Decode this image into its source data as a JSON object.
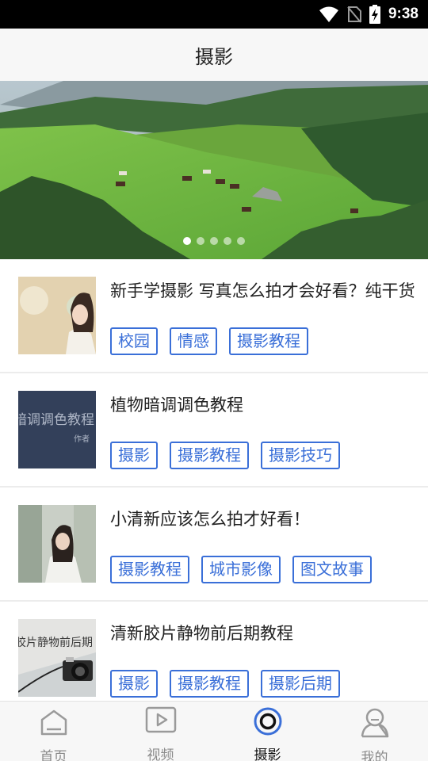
{
  "status_bar": {
    "time": "9:38"
  },
  "header": {
    "title": "摄影"
  },
  "banner": {
    "page_count": 5,
    "active_page": 1
  },
  "articles": [
    {
      "title": "新手学摄影 写真怎么拍才会好看？纯干货",
      "tags": [
        "校园",
        "情感",
        "摄影教程"
      ]
    },
    {
      "title": "植物暗调调色教程",
      "thumb_text": "暗调调色教程",
      "thumb_subtext": "作者",
      "tags": [
        "摄影",
        "摄影教程",
        "摄影技巧"
      ]
    },
    {
      "title": "小清新应该怎么拍才好看！",
      "tags": [
        "摄影教程",
        "城市影像",
        "图文故事"
      ]
    },
    {
      "title": "清新胶片静物前后期教程",
      "thumb_text": "胶片静物前后期",
      "tags": [
        "摄影",
        "摄影教程",
        "摄影后期"
      ]
    }
  ],
  "tabbar": {
    "tabs": [
      {
        "label": "首页",
        "icon": "home-icon"
      },
      {
        "label": "视频",
        "icon": "video-icon"
      },
      {
        "label": "摄影",
        "icon": "camera-lens-icon",
        "active": true
      },
      {
        "label": "我的",
        "icon": "profile-icon"
      }
    ]
  },
  "colors": {
    "accent": "#3a6fd8",
    "status_bar": "#000000",
    "header_bg": "#f7f7f7",
    "tab_active": "#3a6fd8"
  }
}
